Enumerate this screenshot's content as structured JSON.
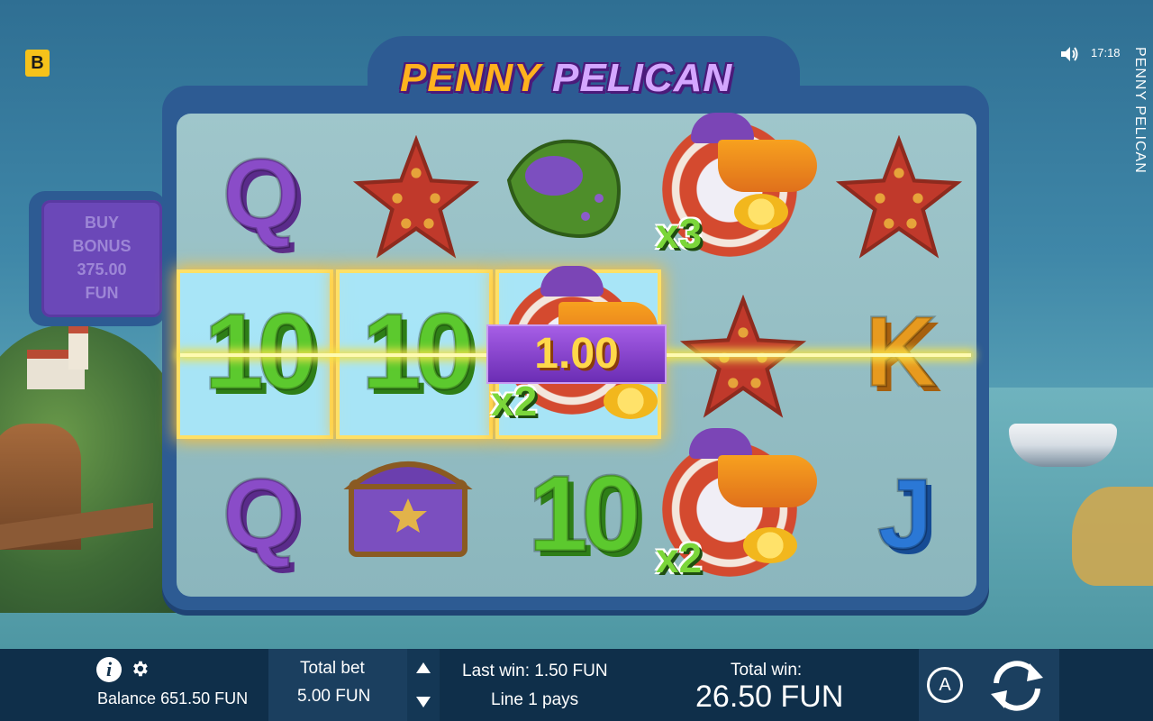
{
  "brand_badge": "B",
  "clock": "17:18",
  "game_title_vertical": "PENNY PELICAN",
  "logo": {
    "word1": "PENNY",
    "word2": "PELICAN"
  },
  "buy_bonus": {
    "line1": "BUY",
    "line2": "BONUS",
    "amount": "375.00",
    "currency": "FUN"
  },
  "reels": {
    "row1": [
      "Q",
      "starfish",
      "shell",
      "pelican x3",
      "starfish"
    ],
    "row2": [
      "10",
      "10",
      "pelican x2",
      "starfish",
      "K"
    ],
    "row3": [
      "Q",
      "chest",
      "10",
      "pelican x2",
      "J"
    ],
    "multipliers": {
      "r1c4": "x3",
      "r2c3": "x2",
      "r3c4": "x2"
    }
  },
  "win_amount": "1.00",
  "bottom": {
    "balance_label": "Balance",
    "balance_value": "651.50 FUN",
    "total_bet_label": "Total bet",
    "total_bet_value": "5.00 FUN",
    "last_win": "Last win: 1.50 FUN",
    "line_message": "Line 1 pays",
    "total_win_label": "Total win:",
    "total_win_value": "26.50 FUN",
    "auto_label": "A"
  },
  "colors": {
    "accent_yellow": "#f6c21a",
    "bar_bg": "#0f2f4a",
    "win_glow": "#ffbe2e",
    "frame": "#2d5b93"
  },
  "icons": [
    "info-icon",
    "gear-icon",
    "sound-icon",
    "arrow-up-icon",
    "arrow-down-icon",
    "autoplay-icon",
    "spin-icon"
  ]
}
